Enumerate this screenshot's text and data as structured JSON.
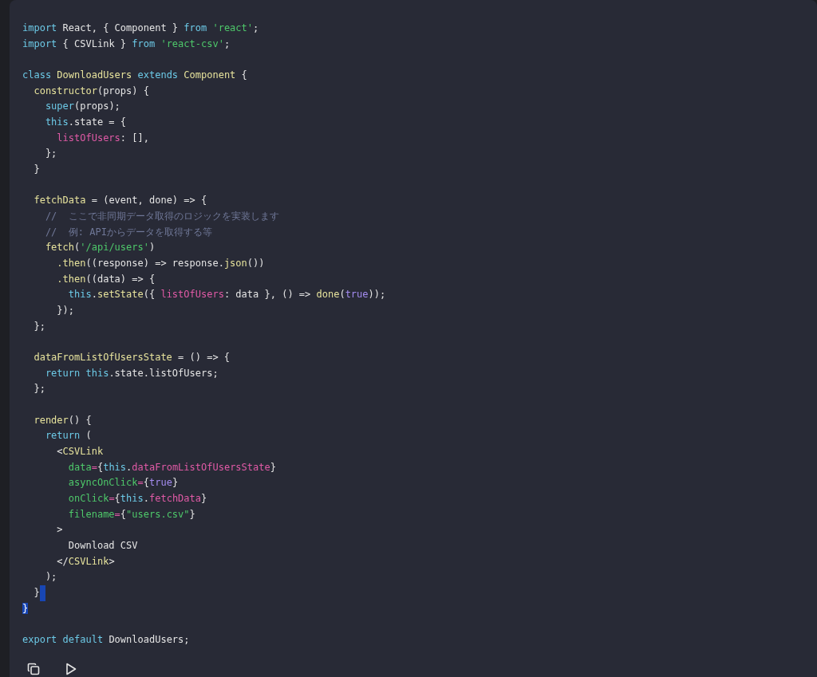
{
  "code_blocks": [
    [
      [
        {
          "text": "import",
          "kind": "keyword"
        },
        {
          "text": " React, { Component } ",
          "kind": "plain"
        },
        {
          "text": "from",
          "kind": "keyword"
        },
        {
          "text": " 'react'",
          "kind": "string"
        },
        {
          "text": ";",
          "kind": "plain"
        }
      ],
      [
        {
          "text": "import",
          "kind": "keyword"
        },
        {
          "text": " { CSVLink } ",
          "kind": "plain"
        },
        {
          "text": "from",
          "kind": "keyword"
        },
        {
          "text": " 'react-csv'",
          "kind": "string"
        },
        {
          "text": ";",
          "kind": "plain"
        }
      ]
    ],
    [
      [
        {
          "text": "class",
          "kind": "keyword"
        },
        {
          "text": " DownloadUsers",
          "kind": "name"
        },
        {
          "text": " extends",
          "kind": "keyword"
        },
        {
          "text": " Component",
          "kind": "name"
        },
        {
          "text": " {",
          "kind": "plain"
        }
      ],
      [
        {
          "text": "  constructor",
          "kind": "name"
        },
        {
          "text": "(props) {",
          "kind": "plain"
        }
      ],
      [
        {
          "text": "    super",
          "kind": "keyword"
        },
        {
          "text": "(props);",
          "kind": "plain"
        }
      ],
      [
        {
          "text": "    this",
          "kind": "keyword"
        },
        {
          "text": ".state = {",
          "kind": "plain"
        }
      ],
      [
        {
          "text": "      listOfUsers",
          "kind": "property"
        },
        {
          "text": ": [],",
          "kind": "plain"
        }
      ],
      [
        {
          "text": "    };",
          "kind": "plain"
        }
      ],
      [
        {
          "text": "  }",
          "kind": "plain"
        }
      ]
    ],
    [
      [
        {
          "text": "  fetchData",
          "kind": "name"
        },
        {
          "text": " = (event, done) => {",
          "kind": "plain"
        }
      ],
      [
        {
          "text": "    //  ここで非同期データ取得のロジックを実装します",
          "kind": "comment"
        }
      ],
      [
        {
          "text": "    //  例: APIからデータを取得する等",
          "kind": "comment"
        }
      ],
      [
        {
          "text": "    fetch",
          "kind": "name"
        },
        {
          "text": "(",
          "kind": "plain"
        },
        {
          "text": "'/api/users'",
          "kind": "string"
        },
        {
          "text": ")",
          "kind": "plain"
        }
      ],
      [
        {
          "text": "      .then",
          "kind": "name"
        },
        {
          "text": "((response) => response.",
          "kind": "plain"
        },
        {
          "text": "json",
          "kind": "name"
        },
        {
          "text": "())",
          "kind": "plain"
        }
      ],
      [
        {
          "text": "      .then",
          "kind": "name"
        },
        {
          "text": "((data) => {",
          "kind": "plain"
        }
      ],
      [
        {
          "text": "        this",
          "kind": "keyword"
        },
        {
          "text": ".",
          "kind": "plain"
        },
        {
          "text": "setState",
          "kind": "name"
        },
        {
          "text": "({ ",
          "kind": "plain"
        },
        {
          "text": "listOfUsers",
          "kind": "property"
        },
        {
          "text": ": data }, () => ",
          "kind": "plain"
        },
        {
          "text": "done",
          "kind": "name"
        },
        {
          "text": "(",
          "kind": "plain"
        },
        {
          "text": "true",
          "kind": "boolean"
        },
        {
          "text": "));",
          "kind": "plain"
        }
      ],
      [
        {
          "text": "      });",
          "kind": "plain"
        }
      ],
      [
        {
          "text": "  };",
          "kind": "plain"
        }
      ]
    ],
    [
      [
        {
          "text": "  dataFromListOfUsersState",
          "kind": "name"
        },
        {
          "text": " = () => {",
          "kind": "plain"
        }
      ],
      [
        {
          "text": "    return this",
          "kind": "keyword"
        },
        {
          "text": ".state.listOfUsers;",
          "kind": "plain"
        }
      ],
      [
        {
          "text": "  };",
          "kind": "plain"
        }
      ]
    ],
    [
      [
        {
          "text": "  render",
          "kind": "name"
        },
        {
          "text": "() {",
          "kind": "plain"
        }
      ],
      [
        {
          "text": "    return",
          "kind": "keyword"
        },
        {
          "text": " (",
          "kind": "plain"
        }
      ],
      [
        {
          "text": "      <",
          "kind": "plain"
        },
        {
          "text": "CSVLink",
          "kind": "name"
        }
      ],
      [
        {
          "text": "        data",
          "kind": "attribute"
        },
        {
          "text": "=",
          "kind": "operator"
        },
        {
          "text": "{",
          "kind": "plain"
        },
        {
          "text": "this",
          "kind": "keyword"
        },
        {
          "text": ".",
          "kind": "plain"
        },
        {
          "text": "dataFromListOfUsersState",
          "kind": "property"
        },
        {
          "text": "}",
          "kind": "plain"
        }
      ],
      [
        {
          "text": "        asyncOnClick",
          "kind": "attribute"
        },
        {
          "text": "=",
          "kind": "operator"
        },
        {
          "text": "{",
          "kind": "plain"
        },
        {
          "text": "true",
          "kind": "boolean"
        },
        {
          "text": "}",
          "kind": "plain"
        }
      ],
      [
        {
          "text": "        onClick",
          "kind": "attribute"
        },
        {
          "text": "=",
          "kind": "operator"
        },
        {
          "text": "{",
          "kind": "plain"
        },
        {
          "text": "this",
          "kind": "keyword"
        },
        {
          "text": ".",
          "kind": "plain"
        },
        {
          "text": "fetchData",
          "kind": "property"
        },
        {
          "text": "}",
          "kind": "plain"
        }
      ],
      [
        {
          "text": "        filename",
          "kind": "attribute"
        },
        {
          "text": "=",
          "kind": "operator"
        },
        {
          "text": "{",
          "kind": "plain"
        },
        {
          "text": "\"users.csv\"",
          "kind": "string"
        },
        {
          "text": "}",
          "kind": "plain"
        }
      ],
      [
        {
          "text": "      >",
          "kind": "plain"
        }
      ],
      [
        {
          "text": "        Download CSV",
          "kind": "plain"
        }
      ],
      [
        {
          "text": "      </",
          "kind": "plain"
        },
        {
          "text": "CSVLink",
          "kind": "name"
        },
        {
          "text": ">",
          "kind": "plain"
        }
      ],
      [
        {
          "text": "    );",
          "kind": "plain"
        }
      ],
      [
        {
          "text": "  }",
          "kind": "plain",
          "selected_line_end": true
        }
      ],
      [
        {
          "text": "}",
          "kind": "selection"
        }
      ]
    ],
    [
      [
        {
          "text": "export default",
          "kind": "keyword"
        },
        {
          "text": " DownloadUsers;",
          "kind": "plain"
        }
      ]
    ]
  ]
}
